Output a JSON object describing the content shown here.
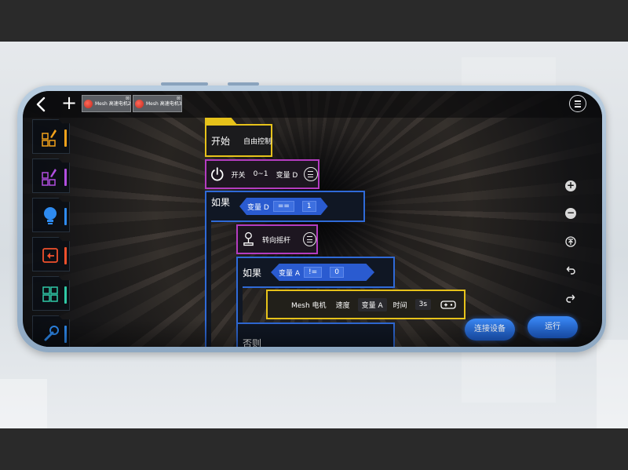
{
  "toolbar": {
    "tabs": [
      {
        "label": "Mesh 高速电机2",
        "close": "⊠"
      },
      {
        "label": "Mesh 高速电机3",
        "close": "⊠"
      }
    ]
  },
  "program": {
    "start": {
      "label": "开始",
      "mode": "自由控制"
    },
    "switch": {
      "label": "开关",
      "range": "0~1",
      "var": "变量 D"
    },
    "if1": {
      "label": "如果",
      "var": "变量 D",
      "op": "==",
      "value": "1"
    },
    "joystick": {
      "label": "转向摇杆"
    },
    "if2": {
      "label": "如果",
      "var": "变量 A",
      "op": "!=",
      "value": "0"
    },
    "motor": {
      "label": "Mesh 电机",
      "speed_label": "速度",
      "speed_var": "变量 A",
      "time_label": "时间",
      "time_value": "3s"
    },
    "else": {
      "label": "否则"
    }
  },
  "actions": {
    "connect": "连接设备",
    "run": "运行"
  },
  "sidebar": {
    "edge_colors": [
      "#f2a21b",
      "#b14fe0",
      "#2e8bf0",
      "#f0502c",
      "#2fc9a6",
      "#2e8bf0"
    ]
  },
  "colors": {
    "event": "#e6c21a",
    "sensor": "#b43cc0",
    "logic": "#2f6ad8",
    "accent": "#2a5bd0"
  }
}
